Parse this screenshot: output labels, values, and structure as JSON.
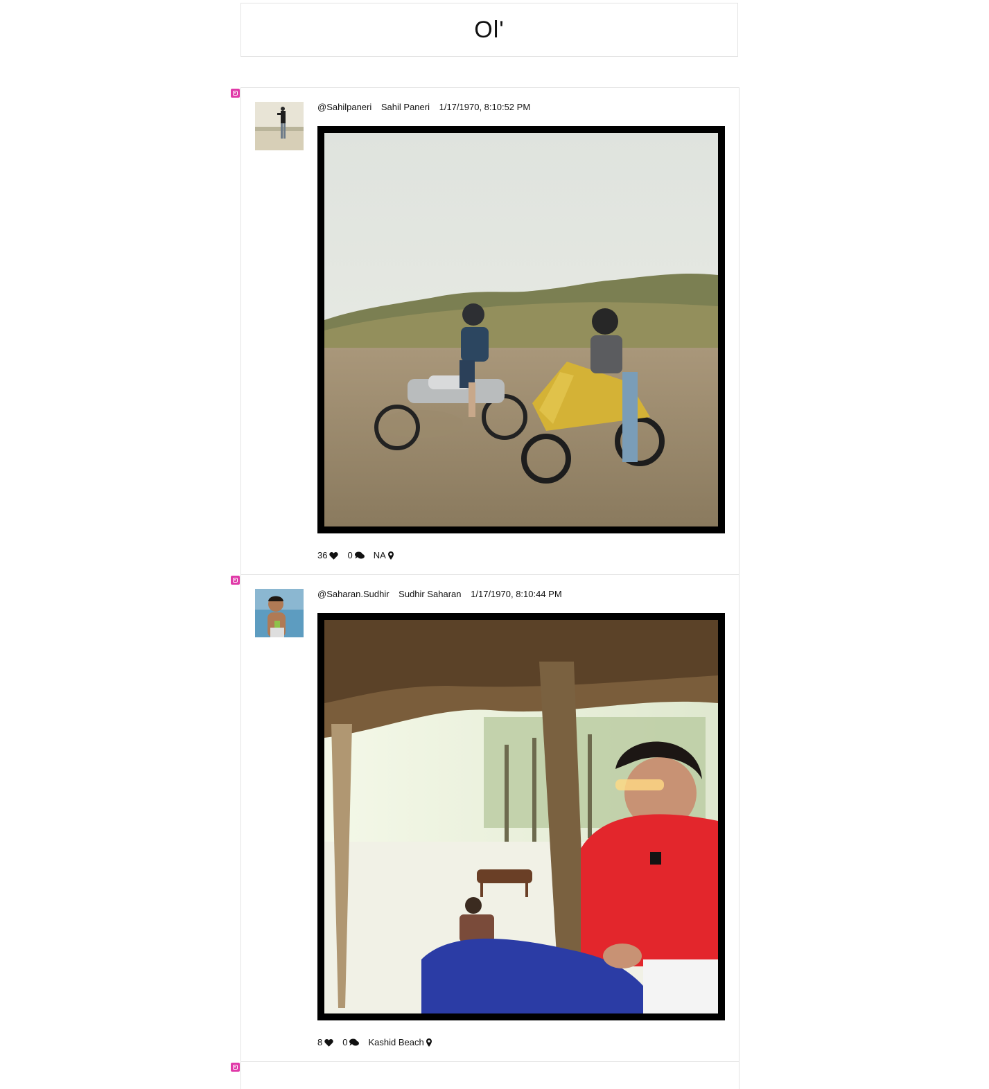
{
  "header": {
    "title": "Ol'"
  },
  "posts": [
    {
      "handle": "@Sahilpaneri",
      "name": "Sahil Paneri",
      "date": "1/17/1970, 8:10:52 PM",
      "likes": "36",
      "comments": "0",
      "location": "NA"
    },
    {
      "handle": "@Saharan.Sudhir",
      "name": "Sudhir Saharan",
      "date": "1/17/1970, 8:10:44 PM",
      "likes": "8",
      "comments": "0",
      "location": "Kashid Beach"
    }
  ],
  "colors": {
    "source_badge": "#e03aa8",
    "border": "#e3e3e3",
    "photo_frame": "#000000"
  },
  "icons": {
    "source": "instagram-icon",
    "like": "heart-icon",
    "comment": "comment-icon",
    "location": "map-pin-icon"
  }
}
